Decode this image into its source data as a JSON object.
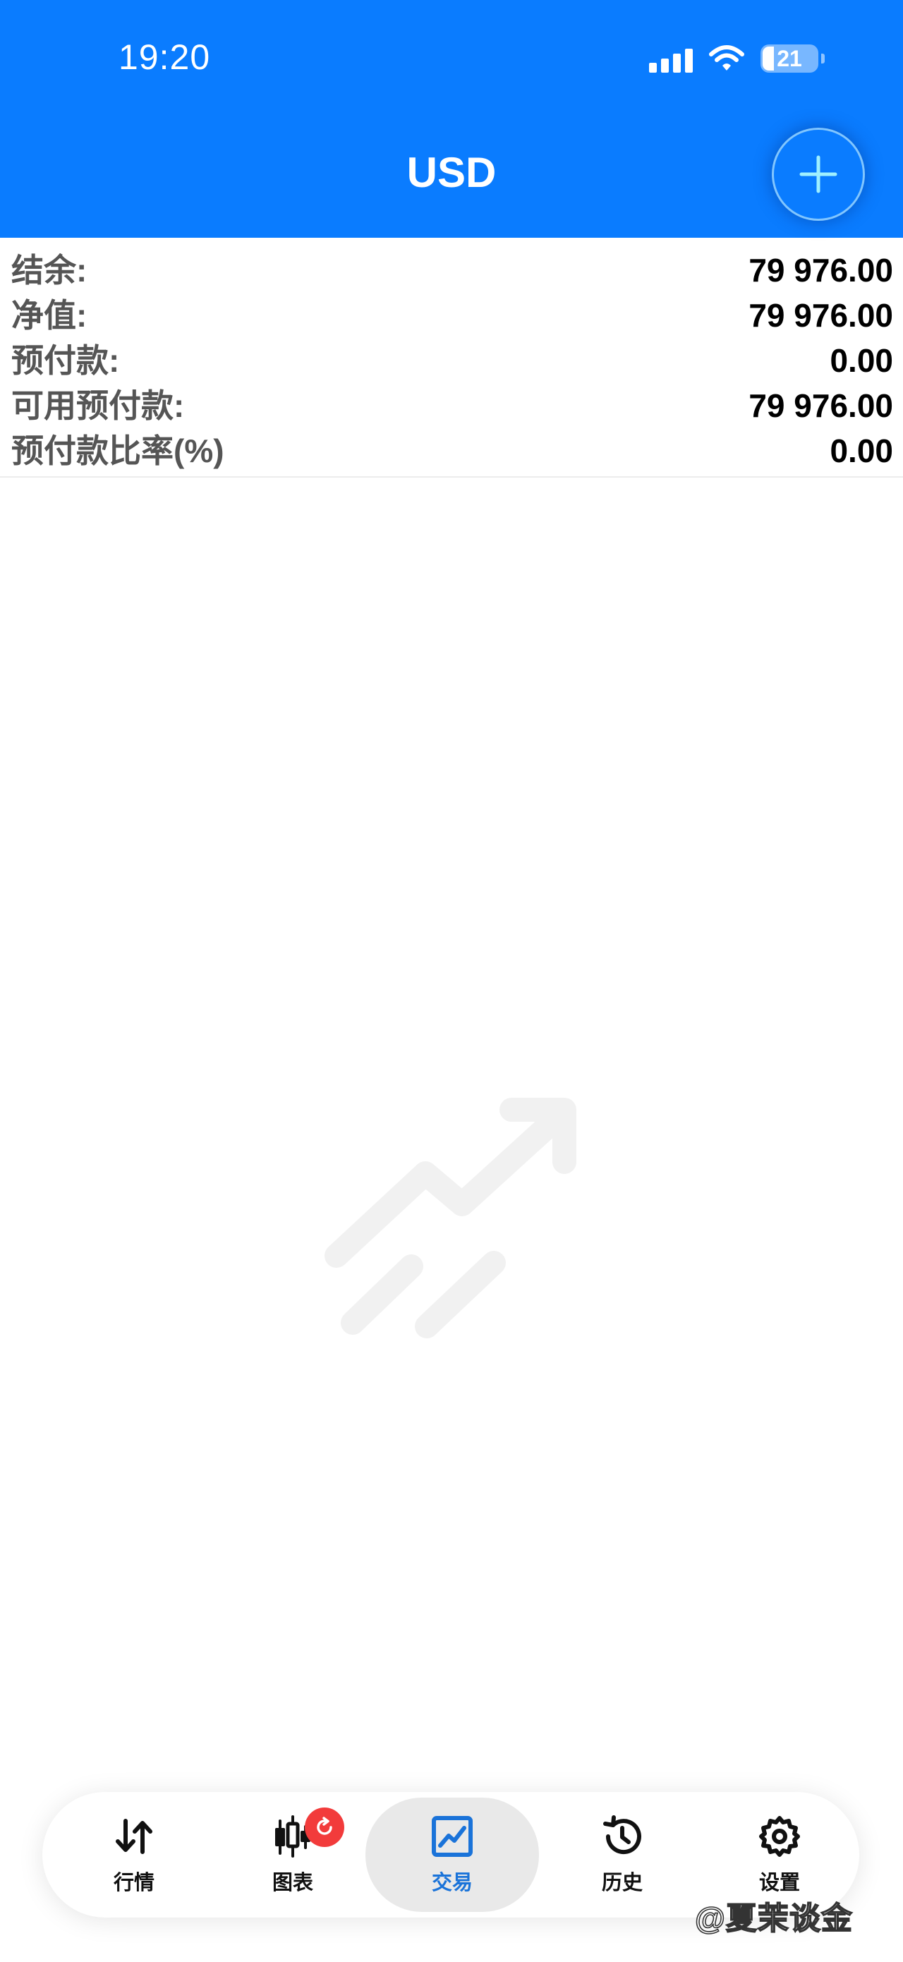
{
  "status_bar": {
    "time": "19:20",
    "battery": "21"
  },
  "header": {
    "title": "USD"
  },
  "summary": [
    {
      "label": "结余:",
      "value": "79 976.00"
    },
    {
      "label": "净值:",
      "value": "79 976.00"
    },
    {
      "label": "预付款:",
      "value": "0.00"
    },
    {
      "label": "可用预付款:",
      "value": "79 976.00"
    },
    {
      "label": "预付款比率(%)",
      "value": "0.00"
    }
  ],
  "tabs": [
    {
      "label": "行情",
      "icon": "quotes-arrows-icon"
    },
    {
      "label": "图表",
      "icon": "candlestick-chart-icon",
      "badge": "refresh"
    },
    {
      "label": "交易",
      "icon": "trade-chart-icon",
      "active": true
    },
    {
      "label": "历史",
      "icon": "history-clock-icon"
    },
    {
      "label": "设置",
      "icon": "gear-icon"
    }
  ],
  "watermark": "@夏茉谈金",
  "colors": {
    "header": "#0a7cff",
    "active_tab_text": "#1a73d9",
    "badge": "#f23b3b"
  }
}
